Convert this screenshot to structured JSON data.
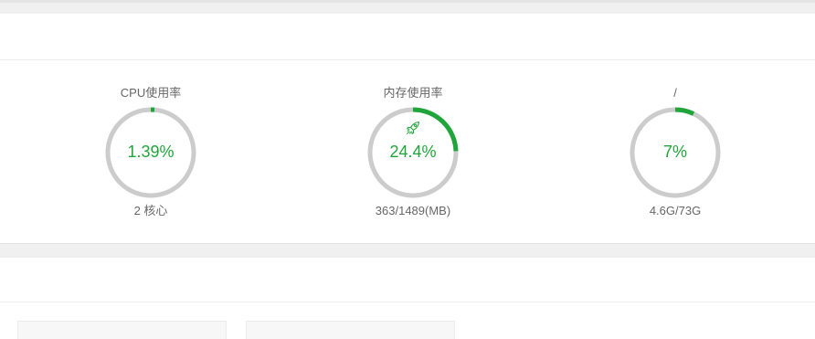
{
  "colors": {
    "accent": "#20a53a",
    "track": "#cccccc",
    "label": "#666666"
  },
  "status": {
    "gauges": [
      {
        "id": "cpu",
        "title": "CPU使用率",
        "value_text": "1.39%",
        "percent": 1.39,
        "sub": "2 核心"
      },
      {
        "id": "memory",
        "title": "内存使用率",
        "value_text": "24.4%",
        "percent": 24.4,
        "sub": "363/1489(MB)",
        "icon": "rocket-icon"
      },
      {
        "id": "disk",
        "title": "/",
        "value_text": "7%",
        "percent": 7,
        "sub": "4.6G/73G"
      }
    ]
  }
}
